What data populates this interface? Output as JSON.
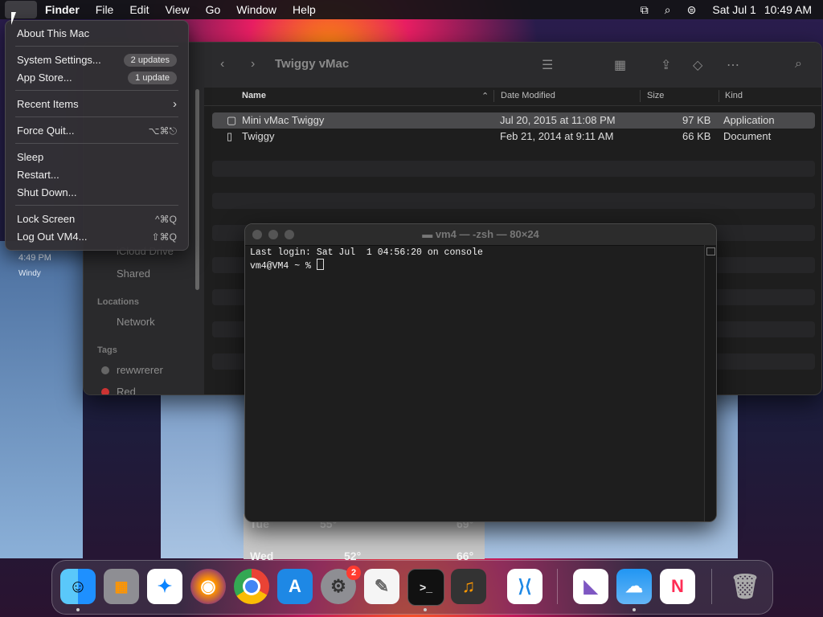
{
  "menubar": {
    "app": "Finder",
    "menus": [
      "File",
      "Edit",
      "View",
      "Go",
      "Window",
      "Help"
    ],
    "date": "Sat Jul 1",
    "time": "10:49 AM"
  },
  "apple_menu": {
    "about": "About This Mac",
    "system_settings": "System Settings...",
    "system_settings_badge": "2 updates",
    "app_store": "App Store...",
    "app_store_badge": "1 update",
    "recent_items": "Recent Items",
    "force_quit": "Force Quit...",
    "force_quit_shortcut": "⌥⌘⎋",
    "sleep": "Sleep",
    "restart": "Restart...",
    "shut_down": "Shut Down...",
    "lock_screen": "Lock Screen",
    "lock_screen_shortcut": "^⌘Q",
    "log_out": "Log Out VM4...",
    "log_out_shortcut": "⇧⌘Q"
  },
  "finder": {
    "title": "Twiggy vMac",
    "columns": {
      "name": "Name",
      "date": "Date Modified",
      "size": "Size",
      "kind": "Kind"
    },
    "rows": [
      {
        "name": "Mini vMac Twiggy",
        "date": "Jul 20, 2015 at 11:08 PM",
        "size": "97 KB",
        "kind": "Application"
      },
      {
        "name": "Twiggy",
        "date": "Feb 21, 2014 at 9:11 AM",
        "size": "66 KB",
        "kind": "Document"
      }
    ],
    "sidebar": {
      "icloud": "iCloud Drive",
      "shared": "Shared",
      "locations_header": "Locations",
      "network": "Network",
      "tags_header": "Tags",
      "tag1": "rewwrerer",
      "tag2": "Red"
    }
  },
  "weather": {
    "time": "4:49 PM",
    "condition": "Windy",
    "day1": "Tue",
    "day1_low": "55°",
    "day1_high": "69°",
    "day2": "Wed",
    "day2_low": "52°",
    "day2_high": "66°"
  },
  "terminal": {
    "title": "vm4 — -zsh — 80×24",
    "line1": "Last login: Sat Jul  1 04:56:20 on console",
    "prompt": "vm4@VM4 ~ % "
  },
  "dock": {
    "items": [
      "finder-icon",
      "launchpad-icon",
      "safari-icon",
      "firefox-icon",
      "chrome-icon",
      "app-store-icon",
      "system-settings-icon",
      "textedit-icon",
      "terminal-icon",
      "instruments-icon",
      "vscode-icon",
      "visual-studio-icon",
      "weather-icon",
      "news-icon",
      "trash-icon"
    ],
    "system_settings_badge": "2"
  },
  "colors": {
    "accent": "#0a84ff",
    "badge_red": "#ff3b30"
  }
}
